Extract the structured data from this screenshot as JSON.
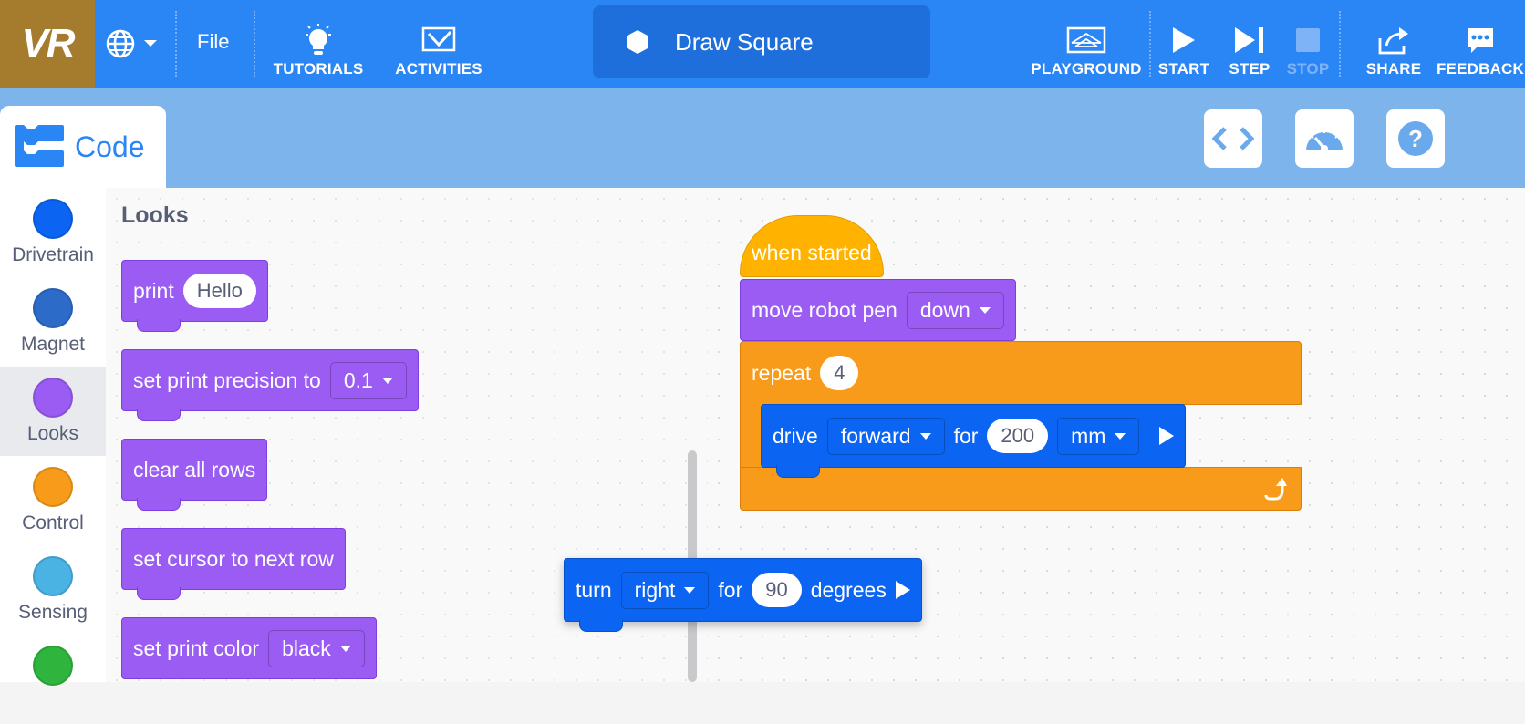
{
  "topbar": {
    "logo": "VR",
    "globe_icon": "globe-icon",
    "file": "File",
    "tutorials": "TUTORIALS",
    "activities": "ACTIVITIES",
    "project_name": "Draw Square",
    "playground": "PLAYGROUND",
    "start": "START",
    "step": "STEP",
    "stop": "STOP",
    "share": "SHARE",
    "feedback": "FEEDBACK"
  },
  "subheader": {
    "code_tab": "Code"
  },
  "categories": [
    {
      "label": "Drivetrain",
      "color": "#0c65f2"
    },
    {
      "label": "Magnet",
      "color": "#2d6bc8"
    },
    {
      "label": "Looks",
      "color": "#9a5cf3"
    },
    {
      "label": "Control",
      "color": "#f89b1a"
    },
    {
      "label": "Sensing",
      "color": "#4ab3e3"
    },
    {
      "label": "",
      "color": "#2fb53d"
    }
  ],
  "flyout": {
    "title": "Looks",
    "print": {
      "label": "print",
      "value": "Hello"
    },
    "precision": {
      "label": "set print precision to",
      "value": "0.1"
    },
    "clear": {
      "label": "clear all rows"
    },
    "cursor": {
      "label": "set cursor to next row"
    },
    "color": {
      "label": "set print color",
      "value": "black"
    }
  },
  "workspace": {
    "when_started": "when started",
    "pen": {
      "label": "move robot pen",
      "value": "down"
    },
    "repeat": {
      "label": "repeat",
      "value": "4"
    },
    "drive": {
      "label": "drive",
      "direction": "forward",
      "for": "for",
      "distance": "200",
      "unit": "mm"
    },
    "turn": {
      "label": "turn",
      "direction": "right",
      "for": "for",
      "angle": "90",
      "unit": "degrees"
    }
  },
  "colors": {
    "topbar": "#2b86f5",
    "subheader": "#7db4ec",
    "looks": "#9a5cf3",
    "drivetrain": "#0c65f2",
    "control": "#f89b1a",
    "events": "#ffb300"
  }
}
